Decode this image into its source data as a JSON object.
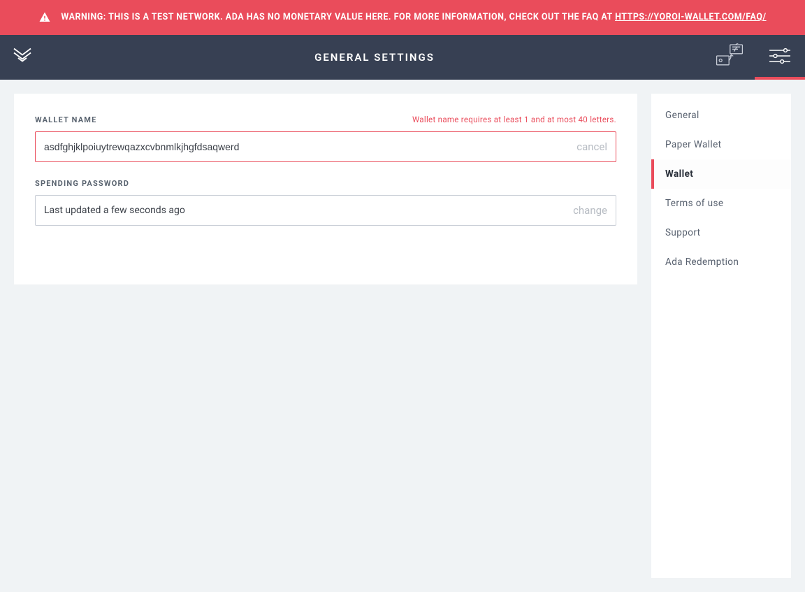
{
  "warning": {
    "text_prefix": "WARNING: THIS IS A TEST NETWORK. ADA HAS NO MONETARY VALUE HERE. FOR MORE INFORMATION, CHECK OUT THE FAQ AT ",
    "link_text": "HTTPS://YOROI-WALLET.COM/FAQ/"
  },
  "header": {
    "title": "GENERAL SETTINGS"
  },
  "form": {
    "wallet_name": {
      "label": "WALLET NAME",
      "error": "Wallet name requires at least 1 and at most 40 letters.",
      "value": "asdfghjklpoiuytrewqazxcvbnmlkjhgfdsaqwerd",
      "action": "cancel"
    },
    "spending_password": {
      "label": "SPENDING PASSWORD",
      "status": "Last updated a few seconds ago",
      "action": "change"
    }
  },
  "sidebar": {
    "items": [
      {
        "label": "General",
        "active": false
      },
      {
        "label": "Paper Wallet",
        "active": false
      },
      {
        "label": "Wallet",
        "active": true
      },
      {
        "label": "Terms of use",
        "active": false
      },
      {
        "label": "Support",
        "active": false
      },
      {
        "label": "Ada Redemption",
        "active": false
      }
    ]
  },
  "colors": {
    "accent": "#ea4c5b",
    "nav_bg": "#374053"
  }
}
